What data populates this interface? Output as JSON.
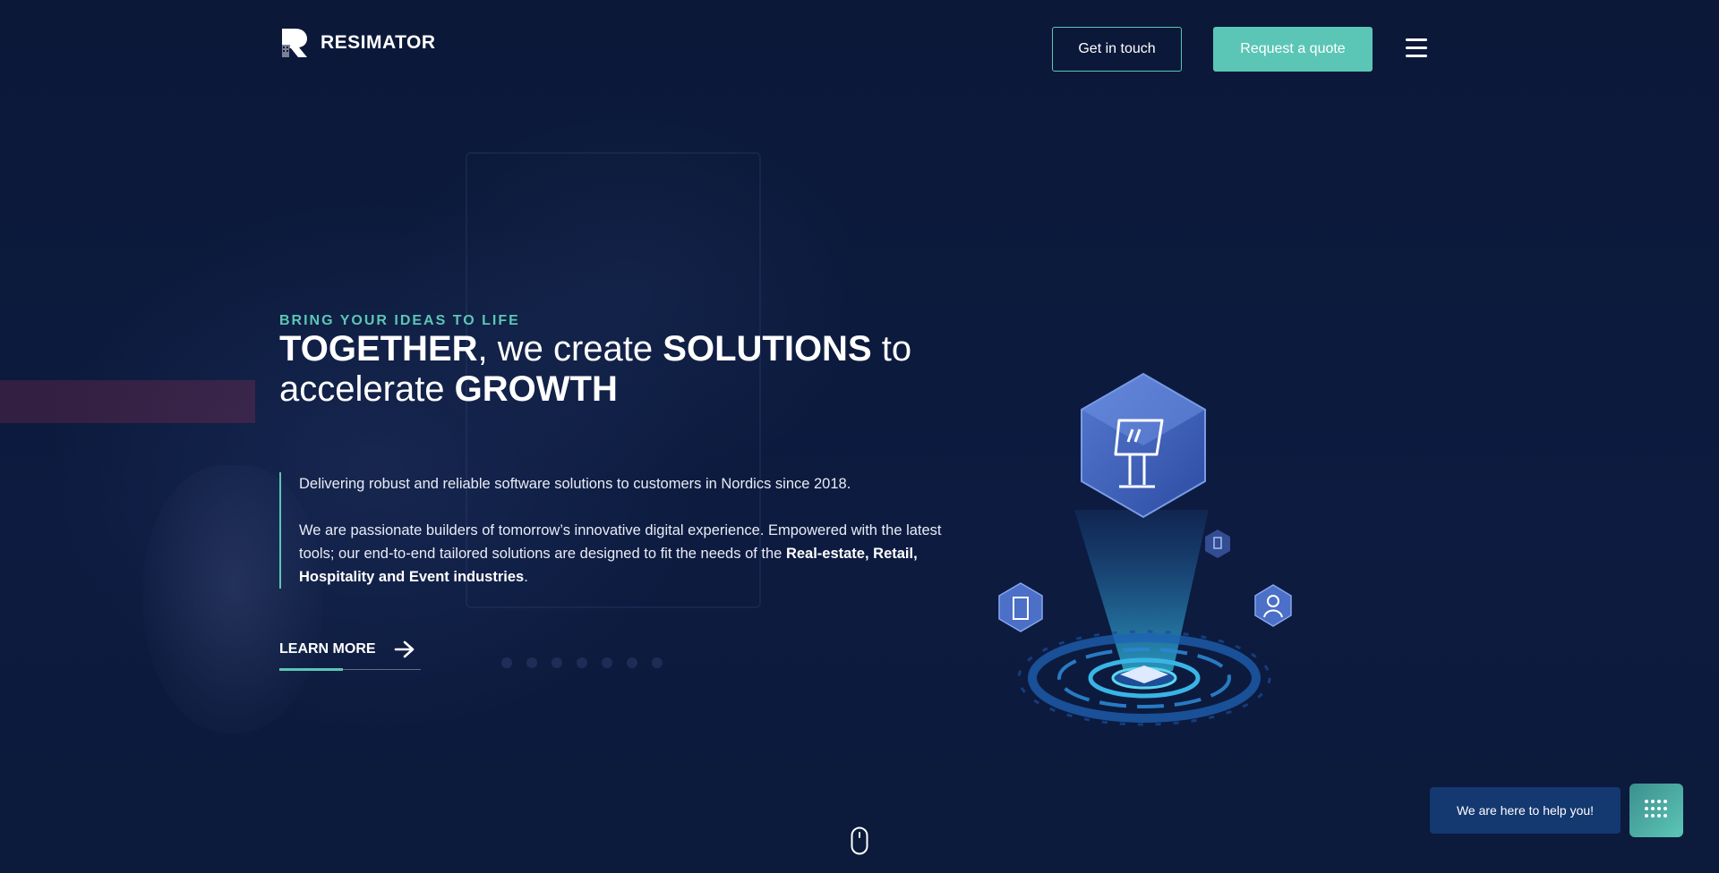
{
  "brand": {
    "name": "RESIMATOR"
  },
  "header": {
    "get_in_touch": "Get in touch",
    "request_quote": "Request a quote",
    "menu_icon": "hamburger-icon"
  },
  "hero": {
    "eyebrow": "BRING YOUR IDEAS TO LIFE",
    "headline": {
      "w1": "TOGETHER",
      "w2": ", we create ",
      "w3": "SOLUTIONS",
      "w4": " to",
      "w5": "accelerate ",
      "w6": "GROWTH"
    },
    "paragraph_1": "Delivering robust and reliable software solutions to customers in Nordics since 2018.",
    "paragraph_2_start": "We are passionate builders of tomorrow’s innovative digital experience. Empowered with the latest tools; our end-to-end tailored solutions are designed to fit the needs of the ",
    "paragraph_2_industries": "Real-estate, Retail, Hospitality and Event industries",
    "paragraph_2_end": ".",
    "learn_more": "LEARN MORE",
    "arrow_icon": "arrow-right-icon"
  },
  "chat": {
    "bubble_text": "We are here to help you!",
    "button_icon": "dial-grid-icon"
  },
  "scroll_indicator_icon": "mouse-scroll-icon",
  "colors": {
    "background": "#0c1a3c",
    "accent": "#5cc6b6",
    "chat_bubble": "#143870"
  }
}
